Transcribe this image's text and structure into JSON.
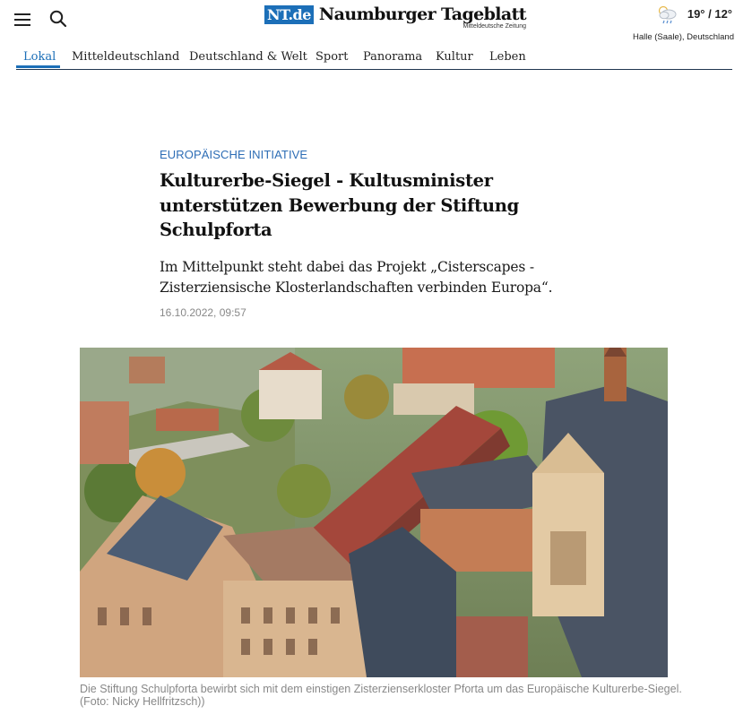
{
  "header": {
    "logo_box": "NT.de",
    "logo_name": "Naumburger Tageblatt",
    "logo_sub": "Mitteldeutsche Zeitung",
    "menu_icon": "hamburger-icon",
    "search_icon": "search-icon",
    "weather": {
      "icon": "rain-cloud-icon",
      "temperature": "19° / 12°",
      "location": "Halle (Saale), Deutschland"
    }
  },
  "nav": {
    "items": [
      "Lokal",
      "Mitteldeutschland",
      "Deutschland & Welt",
      "Sport",
      "Panorama",
      "Kultur",
      "Leben"
    ],
    "active_index": 0
  },
  "article": {
    "kicker": "EUROPÄISCHE INITIATIVE",
    "headline": "Kulturerbe-Siegel - Kultusminister unterstützen Bewerbung der Stiftung Schulpforta",
    "teaser": "Im Mittelpunkt steht dabei das Projekt „Cisterscapes - Zisterziensische Klosterlandschaften verbinden Europa“.",
    "date": "16.10.2022, 09:57",
    "caption": "Die Stiftung Schulpforta bewirbt sich mit dem einstigen Zisterzienserkloster Pforta um das Europäische Kulturerbe-Siegel. (Foto: Nicky Hellfritzsch))"
  },
  "colors": {
    "accent": "#1c6fb8",
    "nav_border": "#1f3650",
    "muted": "#888888"
  }
}
